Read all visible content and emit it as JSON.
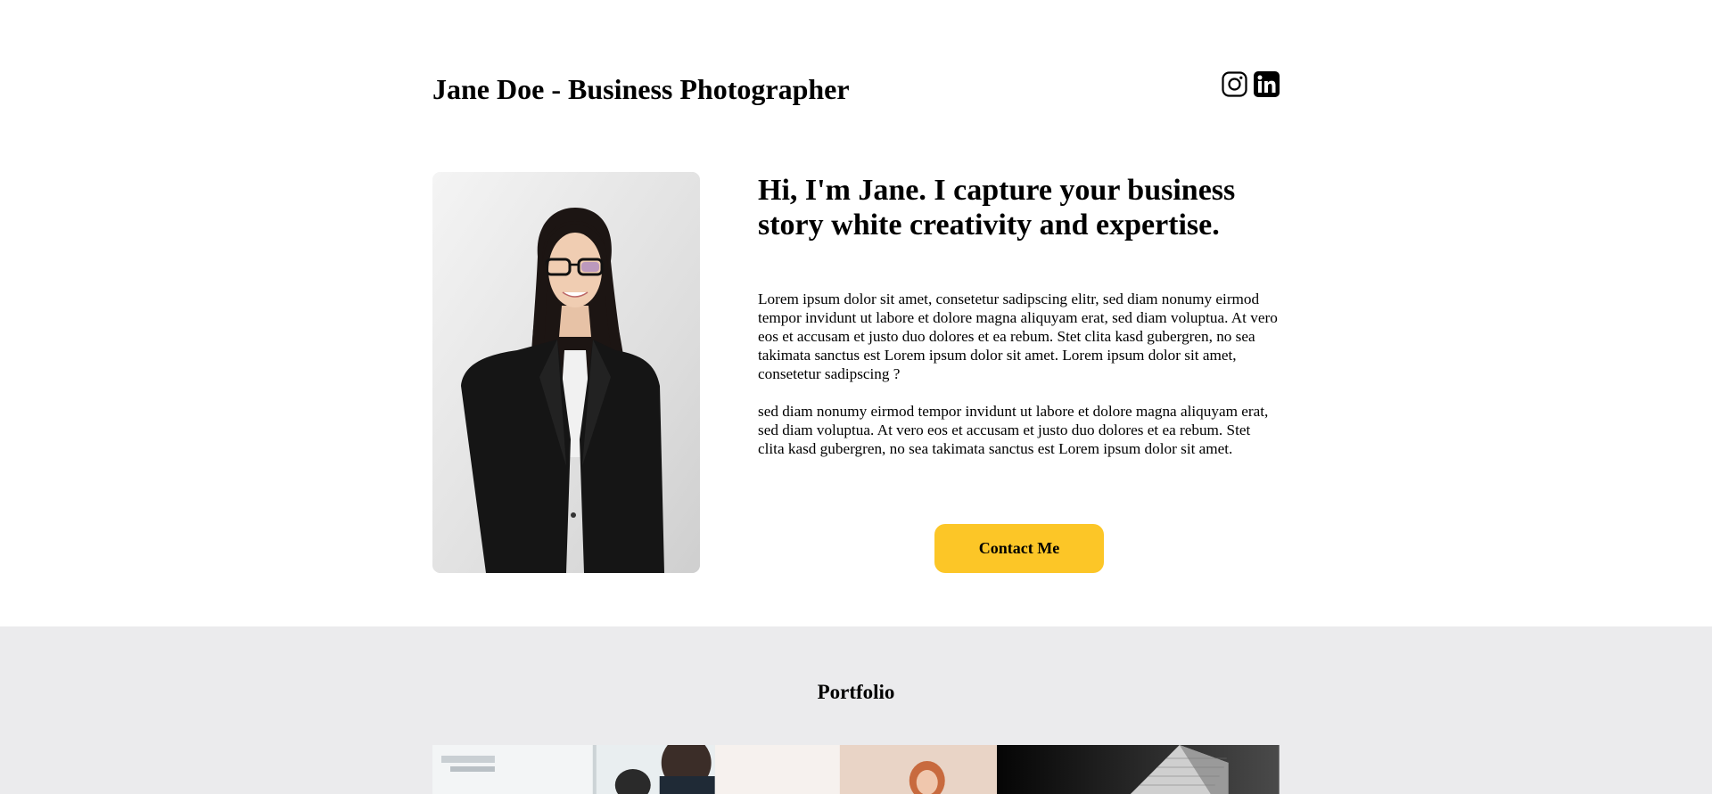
{
  "header": {
    "title": "Jane Doe - Business Photographer",
    "social": [
      {
        "name": "instagram-icon",
        "label": "Instagram"
      },
      {
        "name": "linkedin-icon",
        "label": "LinkedIn"
      }
    ]
  },
  "hero": {
    "portrait_alt": "Portrait of Jane",
    "headline": "Hi, I'm Jane. I capture your business story white creativity and expertise.",
    "paragraph1": "Lorem ipsum dolor sit amet, consetetur sadipscing elitr, sed diam nonumy eirmod tempor invidunt ut labore et dolore magna aliquyam erat, sed diam voluptua. At vero eos et accusam et justo duo dolores et ea rebum. Stet clita kasd gubergren, no sea takimata sanctus est Lorem ipsum dolor sit amet. Lorem ipsum dolor sit amet, consetetur sadipscing ?",
    "paragraph2": "sed diam nonumy eirmod tempor invidunt ut labore et dolore magna aliquyam erat, sed diam voluptua. At vero eos et accusam et justo duo dolores et ea rebum. Stet clita kasd gubergren, no sea takimata sanctus est Lorem ipsum dolor sit amet.",
    "cta_label": "Contact Me"
  },
  "portfolio": {
    "title": "Portfolio",
    "images": [
      "office-meeting",
      "woman-portrait",
      "skyscraper"
    ]
  },
  "colors": {
    "accent": "#fcc627",
    "band": "#ebebed",
    "text": "#000000"
  }
}
